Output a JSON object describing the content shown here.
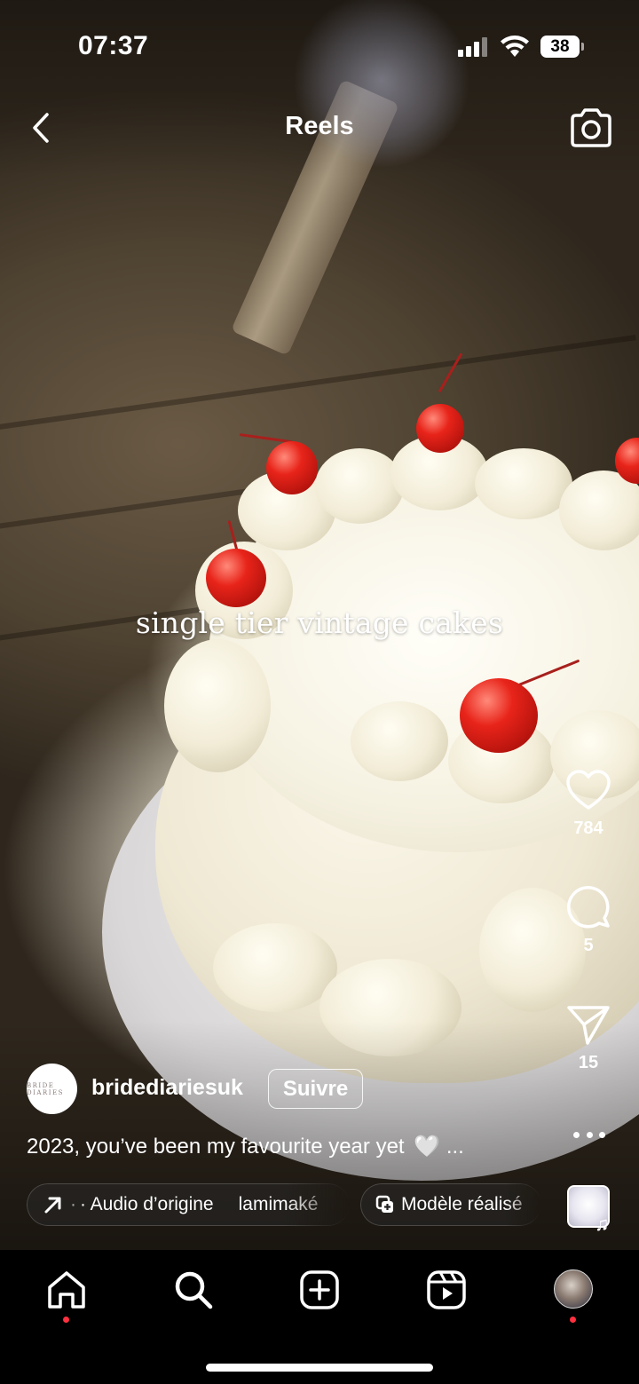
{
  "status_bar": {
    "time": "07:37",
    "battery": "38"
  },
  "header": {
    "title": "Reels"
  },
  "video": {
    "overlay_text": "single tier vintage cakes"
  },
  "actions": {
    "likes": "784",
    "comments": "5",
    "shares": "15"
  },
  "author": {
    "avatar_text": "BRIDE DIARIES",
    "name": "bridediariesuk",
    "follow_label": "Suivre"
  },
  "caption": {
    "text": "2023, you’ve been my favourite year yet",
    "heart": "🤍",
    "more": "..."
  },
  "audio_pill": {
    "prefix": "·",
    "label": "· Audio d’origine",
    "artist": "lamimaké"
  },
  "template_pill": {
    "label": "Modèle réalisé"
  },
  "icons": {
    "back": "chevron-left-icon",
    "camera": "camera-icon",
    "like": "heart-icon",
    "comment": "comment-icon",
    "share": "send-icon",
    "more": "more-icon",
    "home": "home-icon",
    "search": "search-icon",
    "create": "plus-square-icon",
    "reels": "reels-icon"
  },
  "colors": {
    "notification_dot": "#ff3040",
    "background": "#000000"
  }
}
